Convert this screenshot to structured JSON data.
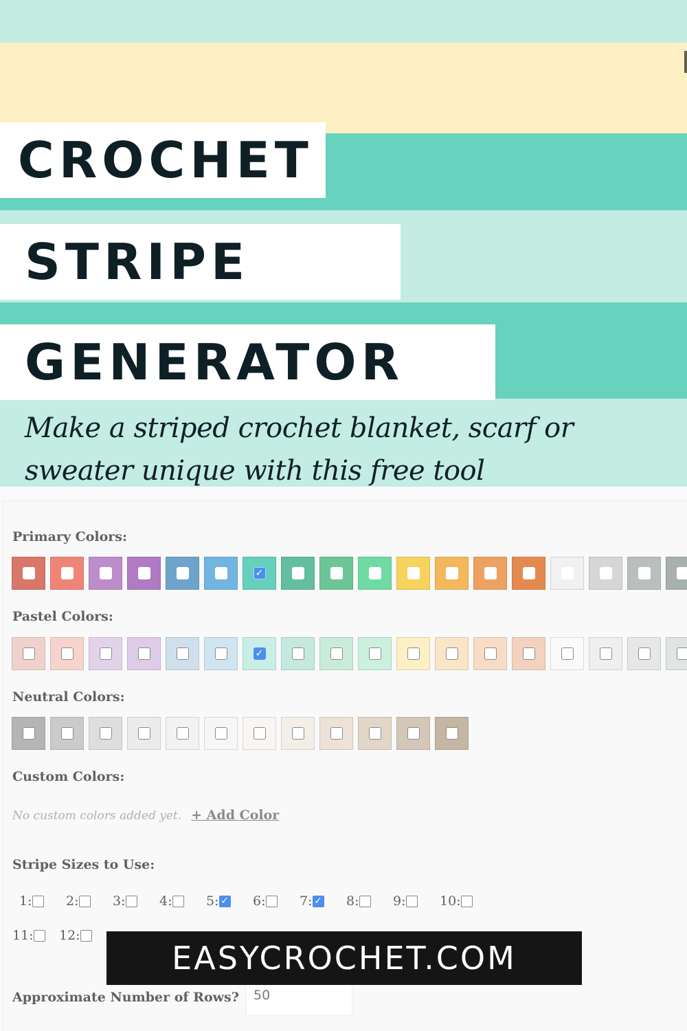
{
  "hero": {
    "title_lines": [
      "CROCHET",
      "STRIPE",
      "GENERATOR"
    ],
    "subtitle": "Make a striped crochet blanket, scarf or sweater unique with this free tool",
    "colors": {
      "mint_light": "#c3ece3",
      "cream": "#fcefc4",
      "teal": "#67d2bd",
      "title_text": "#0e1f26"
    }
  },
  "generator": {
    "primary": {
      "label": "Primary Colors:",
      "swatches": [
        {
          "color": "#d9776a",
          "checked": false
        },
        {
          "color": "#ef8576",
          "checked": false
        },
        {
          "color": "#bd8ccb",
          "checked": false
        },
        {
          "color": "#b07ac4",
          "checked": false
        },
        {
          "color": "#6ea4cc",
          "checked": false
        },
        {
          "color": "#72b5e3",
          "checked": false
        },
        {
          "color": "#65d0bb",
          "checked": true
        },
        {
          "color": "#63bea0",
          "checked": false
        },
        {
          "color": "#6cc596",
          "checked": false
        },
        {
          "color": "#6fdba2",
          "checked": false
        },
        {
          "color": "#f6d35c",
          "checked": false
        },
        {
          "color": "#f4b85c",
          "checked": false
        },
        {
          "color": "#eea261",
          "checked": false
        },
        {
          "color": "#e48a4e",
          "checked": false
        },
        {
          "color": "#f1f1f1",
          "checked": false
        },
        {
          "color": "#d4d6d8",
          "checked": false
        },
        {
          "color": "#b9bfbf",
          "checked": false
        },
        {
          "color": "#a9b0b0",
          "checked": false
        }
      ]
    },
    "pastel": {
      "label": "Pastel Colors:",
      "swatches": [
        {
          "color": "#f0d1cd",
          "checked": false
        },
        {
          "color": "#f6d3cd",
          "checked": false
        },
        {
          "color": "#e3d3ea",
          "checked": false
        },
        {
          "color": "#ddcbe8",
          "checked": false
        },
        {
          "color": "#cfe0ec",
          "checked": false
        },
        {
          "color": "#cfe5f1",
          "checked": false
        },
        {
          "color": "#c9eee7",
          "checked": true
        },
        {
          "color": "#c4e9df",
          "checked": false
        },
        {
          "color": "#c9ecd9",
          "checked": false
        },
        {
          "color": "#cbf0de",
          "checked": false
        },
        {
          "color": "#fcf0c4",
          "checked": false
        },
        {
          "color": "#fbe5c8",
          "checked": false
        },
        {
          "color": "#f8dcc6",
          "checked": false
        },
        {
          "color": "#f3d2bf",
          "checked": false
        },
        {
          "color": "#fafafa",
          "checked": false
        },
        {
          "color": "#efefef",
          "checked": false
        },
        {
          "color": "#e6e8e8",
          "checked": false
        },
        {
          "color": "#e1e4e4",
          "checked": false
        }
      ]
    },
    "neutral": {
      "label": "Neutral Colors:",
      "swatches": [
        {
          "color": "#b5b5b5",
          "checked": false
        },
        {
          "color": "#cbcbcb",
          "checked": false
        },
        {
          "color": "#dedede",
          "checked": false
        },
        {
          "color": "#ebebeb",
          "checked": false
        },
        {
          "color": "#f2f2f2",
          "checked": false
        },
        {
          "color": "#f6f6f6",
          "checked": false
        },
        {
          "color": "#f8f5f2",
          "checked": false
        },
        {
          "color": "#f4eee8",
          "checked": false
        },
        {
          "color": "#ece2d8",
          "checked": false
        },
        {
          "color": "#e1d6c8",
          "checked": false
        },
        {
          "color": "#d3c7b8",
          "checked": false
        },
        {
          "color": "#c4b6a2",
          "checked": false
        }
      ]
    },
    "custom": {
      "label": "Custom Colors:",
      "empty_text": "No custom colors added yet.",
      "add_label": "+ Add Color"
    },
    "stripe_sizes": {
      "label": "Stripe Sizes to Use:",
      "row1": [
        {
          "label": "1:",
          "checked": false
        },
        {
          "label": "2:",
          "checked": false
        },
        {
          "label": "3:",
          "checked": false
        },
        {
          "label": "4:",
          "checked": false
        },
        {
          "label": "5:",
          "checked": true
        },
        {
          "label": "6:",
          "checked": false
        },
        {
          "label": "7:",
          "checked": true
        },
        {
          "label": "8:",
          "checked": false
        },
        {
          "label": "9:",
          "checked": false
        },
        {
          "label": "10:",
          "checked": false
        }
      ],
      "row2": [
        {
          "label": "11:",
          "checked": false
        },
        {
          "label": "12:",
          "checked": false
        }
      ]
    },
    "rows": {
      "label": "Approximate Number of Rows?",
      "value": "50"
    },
    "check_glyph": "✓"
  },
  "watermark": {
    "text": "EASYCROCHET.COM"
  }
}
